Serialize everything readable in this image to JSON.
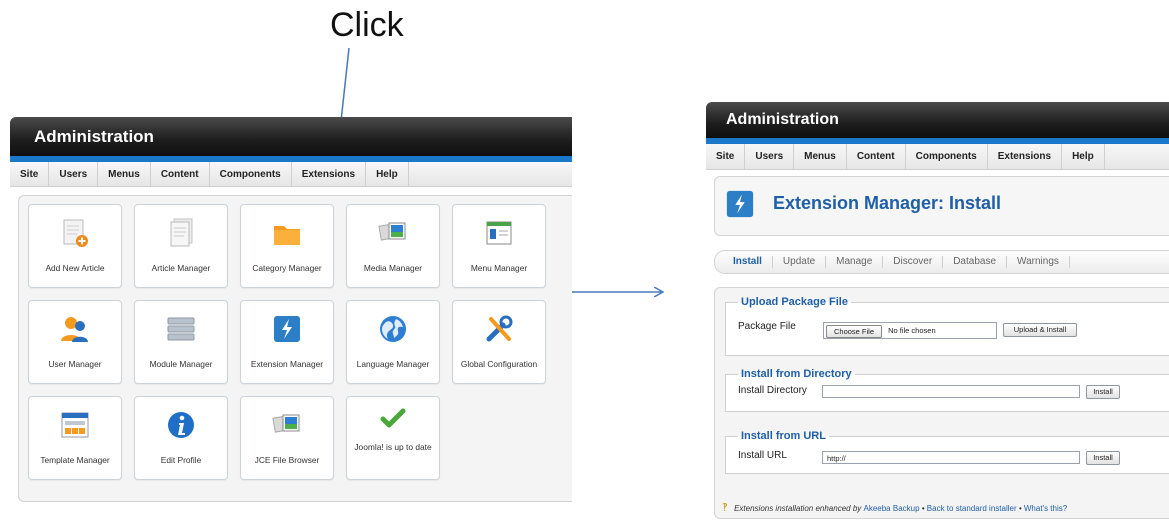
{
  "annotation": {
    "click_label": "Click"
  },
  "left_panel": {
    "header_title": "Administration",
    "menu": [
      "Site",
      "Users",
      "Menus",
      "Content",
      "Components",
      "Extensions",
      "Help"
    ],
    "tiles": [
      {
        "label": "Add New Article",
        "icon": "add-article-icon"
      },
      {
        "label": "Article Manager",
        "icon": "article-icon"
      },
      {
        "label": "Category Manager",
        "icon": "folder-icon"
      },
      {
        "label": "Media Manager",
        "icon": "media-icon"
      },
      {
        "label": "Menu Manager",
        "icon": "menu-icon"
      },
      {
        "label": "User Manager",
        "icon": "users-icon"
      },
      {
        "label": "Module Manager",
        "icon": "module-icon"
      },
      {
        "label": "Extension Manager",
        "icon": "extension-icon"
      },
      {
        "label": "Language Manager",
        "icon": "globe-icon"
      },
      {
        "label": "Global Configuration",
        "icon": "tools-icon"
      },
      {
        "label": "Template Manager",
        "icon": "template-icon"
      },
      {
        "label": "Edit Profile",
        "icon": "info-icon"
      },
      {
        "label": "JCE File Browser",
        "icon": "file-browser-icon"
      },
      {
        "label": "Joomla! is up to date",
        "icon": "checkmark-icon"
      }
    ]
  },
  "right_panel": {
    "header_title": "Administration",
    "menu": [
      "Site",
      "Users",
      "Menus",
      "Content",
      "Components",
      "Extensions",
      "Help"
    ],
    "page_title": "Extension Manager: Install",
    "tabs": [
      "Install",
      "Update",
      "Manage",
      "Discover",
      "Database",
      "Warnings"
    ],
    "upload": {
      "legend": "Upload Package File",
      "label": "Package File",
      "choose_button": "Choose File",
      "no_file": "No file chosen",
      "install_button": "Upload & Install"
    },
    "directory": {
      "legend": "Install from Directory",
      "label": "Install Directory",
      "value": "",
      "install_button": "Install"
    },
    "url": {
      "legend": "Install from URL",
      "label": "Install URL",
      "value": "http://",
      "install_button": "Install"
    },
    "footnote": {
      "prefix": "Extensions installation enhanced by ",
      "akeeba": "Akeeba Backup",
      "sep1": " • ",
      "back": "Back to standard installer",
      "sep2": " • ",
      "whats": "What's this?"
    }
  },
  "colors": {
    "accent_blue": "#1a77c9",
    "title_blue": "#1f5fa8",
    "arrow_blue": "#4a78b8"
  }
}
